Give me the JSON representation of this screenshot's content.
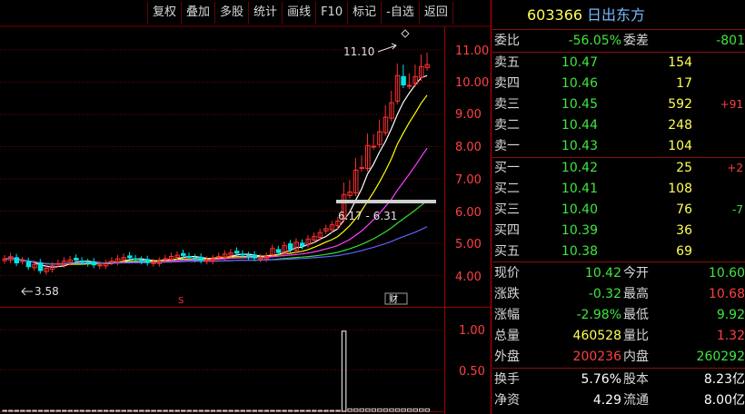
{
  "toolbar": {
    "buttons": [
      "复权",
      "叠加",
      "多股",
      "统计",
      "画线",
      "F10",
      "标记",
      "-自选",
      "返回"
    ]
  },
  "chart": {
    "price_axis": [
      "11.00",
      "10.00",
      "9.00",
      "8.00",
      "7.00",
      "6.00",
      "5.00",
      "4.00"
    ],
    "volume_axis": [
      "1.00",
      "0.50"
    ],
    "high_annotation": "11.10",
    "low_annotation": "3.58",
    "range_annotation": "6.17 - 6.31",
    "marker_s": "S",
    "marker_finance": "财",
    "colors": {
      "grid": "#7a0000",
      "up": "#ff3030",
      "down": "#00e5e5",
      "ma5": "#ffffff",
      "ma10": "#ffff00",
      "ma20": "#ff40ff",
      "ma60": "#30e030",
      "ma120": "#6060ff"
    }
  },
  "quote": {
    "code": "603366",
    "name": "日出东方",
    "weibi": {
      "label": "委比",
      "value": "-56.05%"
    },
    "weicha": {
      "label": "委差",
      "value": "-801"
    },
    "asks": [
      {
        "label": "卖五",
        "price": "10.47",
        "vol": "154",
        "chg": ""
      },
      {
        "label": "卖四",
        "price": "10.46",
        "vol": "17",
        "chg": ""
      },
      {
        "label": "卖三",
        "price": "10.45",
        "vol": "592",
        "chg": "+91"
      },
      {
        "label": "卖二",
        "price": "10.44",
        "vol": "248",
        "chg": ""
      },
      {
        "label": "卖一",
        "price": "10.43",
        "vol": "104",
        "chg": ""
      }
    ],
    "bids": [
      {
        "label": "买一",
        "price": "10.42",
        "vol": "25",
        "chg": "+2"
      },
      {
        "label": "买二",
        "price": "10.41",
        "vol": "108",
        "chg": ""
      },
      {
        "label": "买三",
        "price": "10.40",
        "vol": "76",
        "chg": "-7"
      },
      {
        "label": "买四",
        "price": "10.39",
        "vol": "36",
        "chg": ""
      },
      {
        "label": "买五",
        "price": "10.38",
        "vol": "69",
        "chg": ""
      }
    ],
    "stats": [
      {
        "l1": "现价",
        "v1": "10.42",
        "l2": "今开",
        "v2": "10.60"
      },
      {
        "l1": "涨跌",
        "v1": "-0.32",
        "l2": "最高",
        "v2": "10.68"
      },
      {
        "l1": "涨幅",
        "v1": "-2.98%",
        "l2": "最低",
        "v2": "9.92"
      },
      {
        "l1": "总量",
        "v1": "460528",
        "l2": "量比",
        "v2": "1.32"
      },
      {
        "l1": "外盘",
        "v1": "200236",
        "l2": "内盘",
        "v2": "260292"
      }
    ],
    "extra": [
      {
        "l1": "换手",
        "v1": "5.76%",
        "l2": "股本",
        "v2": "8.23亿"
      },
      {
        "l1": "净资",
        "v1": "4.29",
        "l2": "流通",
        "v2": "8.00亿"
      }
    ]
  }
}
